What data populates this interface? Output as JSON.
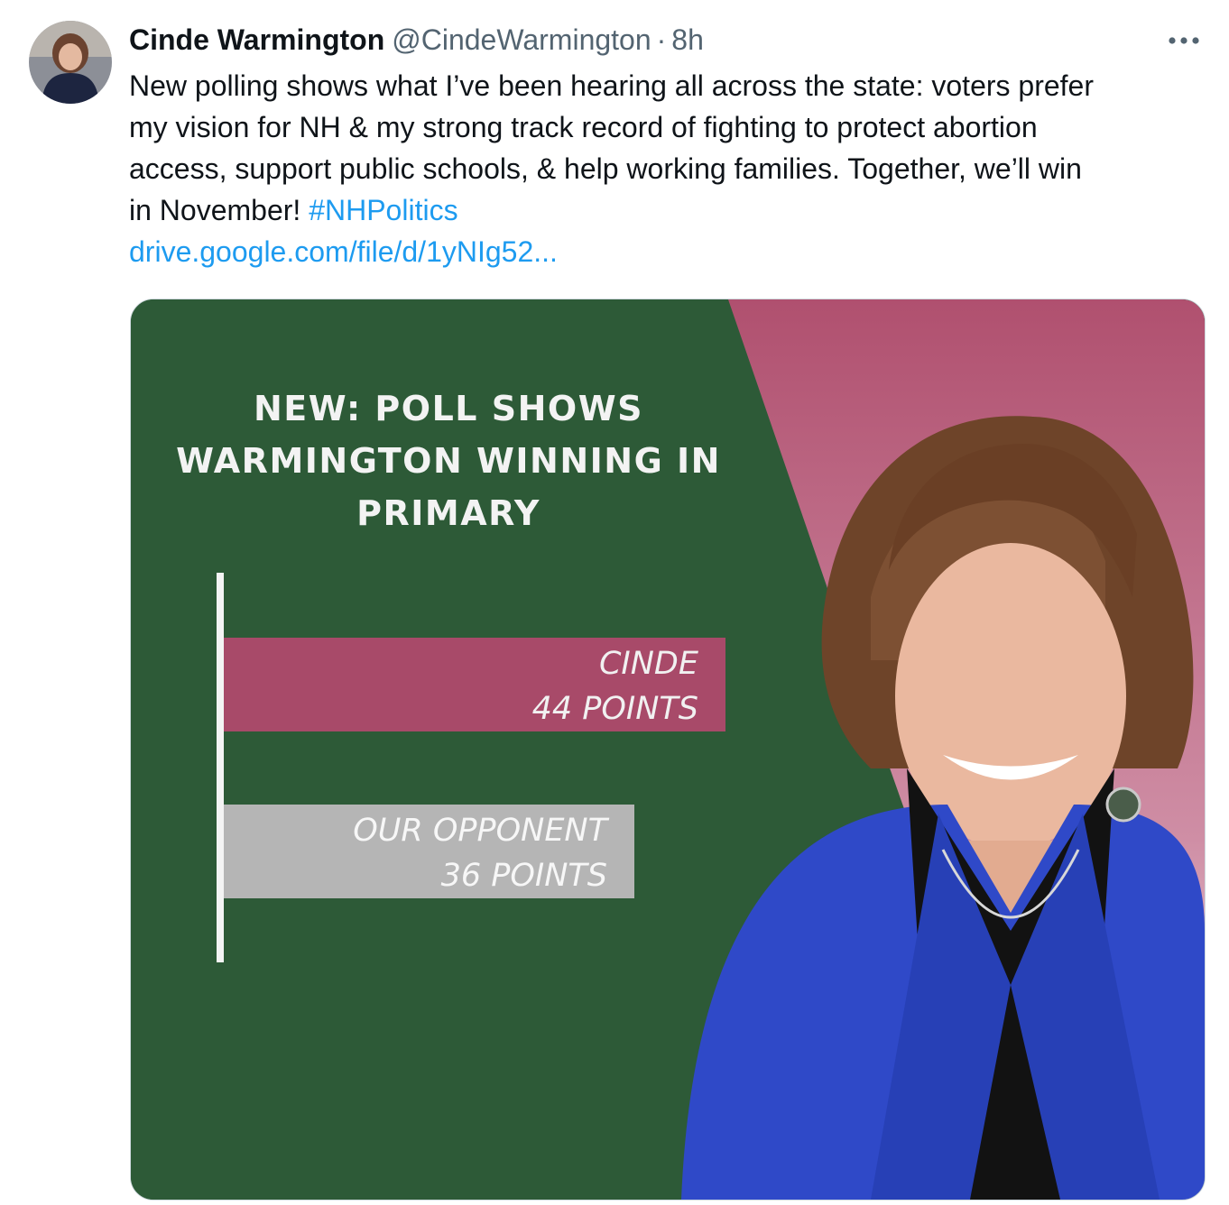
{
  "author": {
    "display_name": "Cinde Warmington",
    "handle": "@CindeWarmington",
    "separator": "·",
    "time_ago": "8h"
  },
  "tweet": {
    "lines": [
      "New polling shows what I’ve been hearing all across the state: voters prefer",
      "my vision for NH & my strong track record of fighting to protect abortion",
      "access, support public schools, & help working families. Together, we’ll win"
    ],
    "last_line_text": "in November! ",
    "hashtag": "#NHPolitics",
    "link": "drive.google.com/file/d/1yNIg52..."
  },
  "icons": {
    "more": "more-horizontal-icon",
    "avatar": "profile-photo"
  },
  "media_graphic": {
    "title_lines": [
      "NEW: POLL SHOWS",
      "WARMINGTON WINNING IN",
      "PRIMARY"
    ],
    "colors": {
      "background": "#2d5a37",
      "accent_pink": "#a84a69",
      "opponent_gray": "#b5b5b5",
      "jacket_blue": "#2f49c8"
    }
  },
  "chart_data": {
    "type": "bar",
    "orientation": "horizontal",
    "categories": [
      "CINDE",
      "OUR OPPONENT"
    ],
    "values": [
      44,
      36
    ],
    "value_labels": [
      "44 POINTS",
      "36 POINTS"
    ],
    "title": "NEW: POLL SHOWS WARMINGTON WINNING IN PRIMARY",
    "xlabel": "",
    "ylabel": "",
    "grid": false
  }
}
